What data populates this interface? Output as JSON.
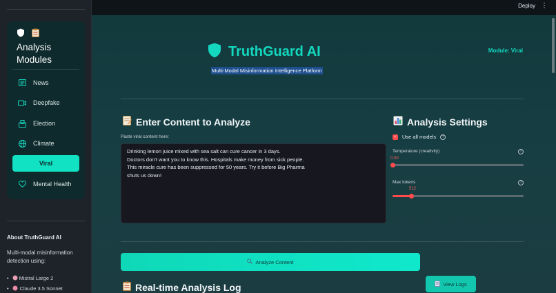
{
  "topbar": {
    "deploy_label": "Deploy",
    "menu_icon": "kebab-menu-icon"
  },
  "sidebar": {
    "card_title": "Analysis Modules",
    "items": [
      {
        "label": "News",
        "icon": "newspaper-icon"
      },
      {
        "label": "Deepfake",
        "icon": "video-camera-icon"
      },
      {
        "label": "Election",
        "icon": "ballot-box-icon"
      },
      {
        "label": "Climate",
        "icon": "globe-icon"
      },
      {
        "label": "Viral",
        "icon": "",
        "active": true
      },
      {
        "label": "Mental Health",
        "icon": "heart-icon"
      }
    ],
    "about_title": "About TruthGuard AI",
    "about_desc": "Multi-modal misinformation detection using:",
    "models": [
      "Mistral Large 2",
      "Claude 3.5 Sonnet"
    ]
  },
  "header": {
    "title": "TruthGuard AI",
    "subtitle": "Multi-Modal Misinformation Intelligence Platform",
    "module_label": "Module: Viral"
  },
  "content": {
    "section_title": "Enter Content to Analyze",
    "field_label": "Paste viral content here:",
    "text_value": "Drinking lemon juice mixed with sea salt can cure cancer in 3 days.\nDoctors don't want you to know this. Hospitals make money from sick people.\nThis miracle cure has been suppressed for 50 years. Try it before Big Pharma\nshuts us down!"
  },
  "settings": {
    "section_title": "Analysis Settings",
    "use_all_models_label": "Use all models",
    "use_all_models_checked": true,
    "temperature": {
      "label": "Temperature (creativity)",
      "value": "0.00",
      "fraction": 0.0
    },
    "max_tokens": {
      "label": "Max tokens",
      "value": "512",
      "fraction": 0.14
    }
  },
  "actions": {
    "analyze_label": "Analyze Content",
    "log_title": "Real-time Analysis Log",
    "view_logs_label": "View Logs"
  },
  "colors": {
    "accent": "#13d8bf",
    "slider": "#ff4b4b",
    "sidebar_bg": "#1e2329"
  }
}
